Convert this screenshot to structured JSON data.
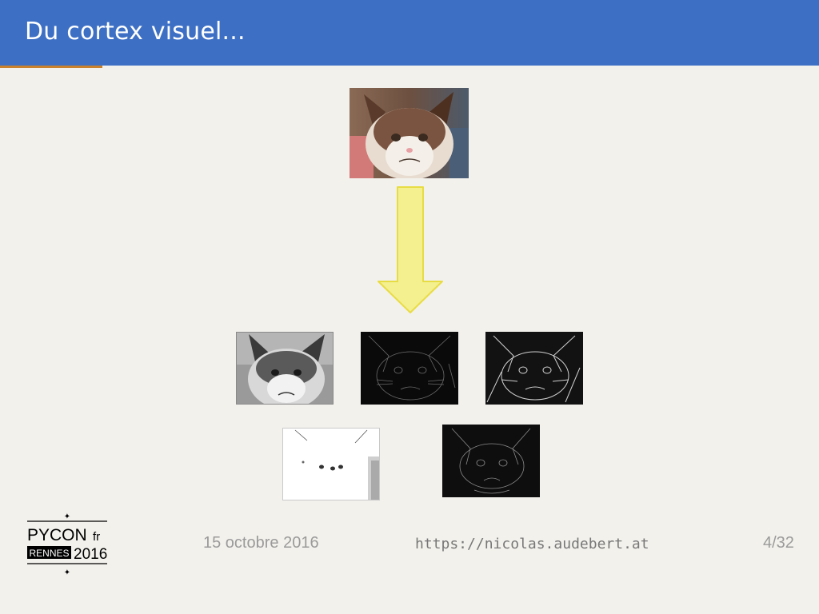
{
  "slide": {
    "title": "Du cortex visuel..."
  },
  "footer": {
    "date": "15 octobre 2016",
    "url": "https://nicolas.audebert.at",
    "page": "4/32"
  },
  "logo": {
    "brand": "PYCON",
    "suffix": "fr",
    "city": "RENNES",
    "year": "2016"
  },
  "colors": {
    "header": "#3d6fc4",
    "arrow_fill": "#f4ef8f",
    "arrow_stroke": "#e8dc44",
    "progress": "#c9812b"
  }
}
